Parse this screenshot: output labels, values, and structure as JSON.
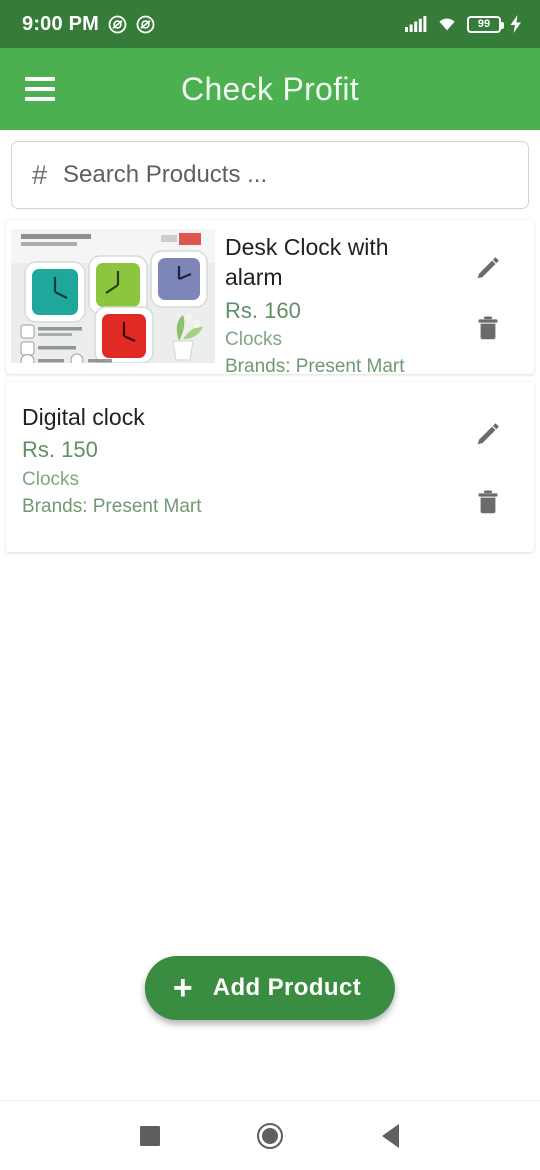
{
  "status_bar": {
    "time": "9:00 PM",
    "dnd_icon": "do-not-disturb-icon",
    "silent_icon": "notification-silenced-icon",
    "signal_icon": "cellular-signal-icon",
    "wifi_icon": "wifi-icon",
    "battery_level": "99",
    "charging_icon": "charging-bolt-icon",
    "background_color": "#367c39"
  },
  "app_bar": {
    "title": "Check Profit",
    "menu_icon": "hamburger-menu-icon",
    "background_color": "#4caf50"
  },
  "search": {
    "icon": "hash-icon",
    "placeholder": "Search Products ...",
    "value": ""
  },
  "products": [
    {
      "name": "Desk Clock with alarm",
      "price": "Rs. 160",
      "category": "Clocks",
      "brand": "Brands: Present Mart",
      "has_image": true,
      "image_alt": "four square alarm clocks teal green purple red",
      "edit_icon": "pencil-icon",
      "delete_icon": "trash-icon"
    },
    {
      "name": "Digital clock",
      "price": "Rs. 150",
      "category": "Clocks",
      "brand": "Brands: Present Mart",
      "has_image": false,
      "edit_icon": "pencil-icon",
      "delete_icon": "trash-icon"
    }
  ],
  "add_product": {
    "label": "Add Product",
    "plus_icon": "plus-icon",
    "color": "#3a8c40"
  },
  "nav_bar": {
    "recents": "recents-square-icon",
    "home": "home-circle-icon",
    "back": "back-triangle-icon"
  },
  "colors": {
    "price_green": "#5f8f63",
    "category_green": "#7fa684",
    "accent_green": "#4caf50"
  }
}
